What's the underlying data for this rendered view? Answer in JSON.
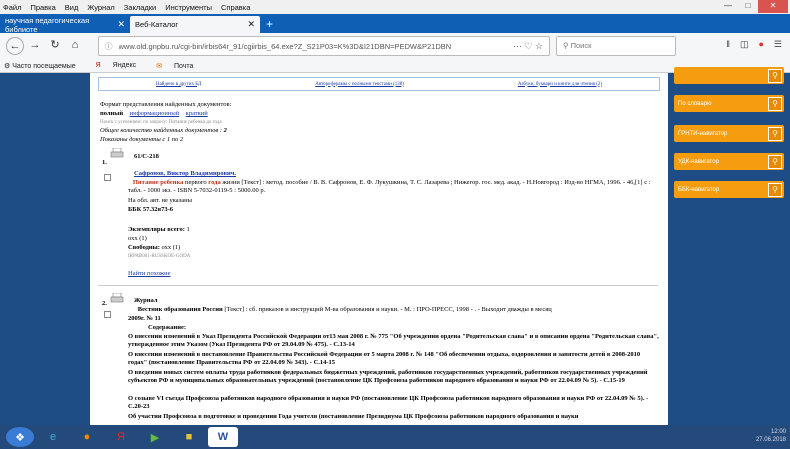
{
  "menu": [
    "Файл",
    "Правка",
    "Вид",
    "Журнал",
    "Закладки",
    "Инструменты",
    "Справка"
  ],
  "tabs": [
    {
      "label": "научная педагогическая библиоте"
    },
    {
      "label": "Веб-Каталог"
    }
  ],
  "url": "www.old.gnpbu.ru/cgi-bin/irbis64r_91/cgiirbis_64.exe?Z_S21P03=K%3D&I21DBN=PEDW&P21DBN",
  "search_placeholder": "Поиск",
  "bookmarks": [
    "Часто посещаемые",
    "Яндекс",
    "Почта"
  ],
  "sidebar": [
    {
      "label": "По словарю"
    },
    {
      "label": "ГРНТИ-навигатор"
    },
    {
      "label": "УДК-навигатор"
    },
    {
      "label": "ББК-навигатор"
    }
  ],
  "toplinks": [
    "Найдено в других БД",
    "Автореферамы с полными текстами (138)",
    "Азбуки, буквари и книги для чтения (2)"
  ],
  "format_title": "Формат представления найденных документов:",
  "formats": {
    "full": "полный",
    "info": "информационный",
    "short": "краткий"
  },
  "query_note": "Поиск с усечением: по запросу: Питание ребенка до года",
  "total_label": "Общее количество найденных документов :",
  "total": "2",
  "shown_label": "Показаны документы с 1 по 2",
  "rec1": {
    "num": "1.",
    "code": "61/С-218",
    "author": "Сафронов, Виктор Владимирович.",
    "title_red": "Питание ребенка",
    "title_rest": " первого ",
    "title_red2": "года",
    "desc": " жизни [Текст] : метод. пособие / В. В. Сафронов, Е. Ф. Лукушкина, Т. С. Лазарева ; Нижегор. гос. мед. акад. - Н.Новгород : Изд-во НГМА, 1996. - 46,[1] с : табл. - 1000 экз. - ISBN 5-7032-0119-5 : 5000.00 р.",
    "note": "На обл. авт. не указаны",
    "bbk": "ББК 57.32я73-6",
    "copies_label": "Экземпляры всего:",
    "copies": "1",
    "okh1": "охх (1)",
    "free_label": "Свободны:",
    "free": "охх (1)",
    "code2": "IRPAB001-RUSSKOE-GODA",
    "similar": "Найти похожие"
  },
  "rec2": {
    "num": "2.",
    "type": "Журнал",
    "title": "Вестник образования России",
    "desc": " [Текст] : сб. приказов и инструкций М-ва образования и науки. - М. : ПРО-ПРЕСС, 1998 - . - Выходит дважды в месяц",
    "issue": "2009г. № 11",
    "contents": "Содержание:",
    "items": [
      "О внесении изменений в Указ Президента Российской Федерации от13 мая 2008 г. № 775 \"Об учреждении ордена \"Родительская слава\" и в описании ордена \"Родительская слава\", утвержденное этим Указом (Указ Президента РФ от 29.04.09 № 475). - С.13-14",
      "О внесении изменений в постановление Правительства Российской Федерации от 5 марта 2008 г. № 148 \"Об обеспечении отдыха, оздоровления и занятости детей в 2008-2010 годах\" (постановление Правительства РФ от 22.04.09 № 343). - С.14-15",
      "О введении новых систем оплаты труда работников федеральных бюджетных учреждений, работников государственных учреждений, работников государственных учреждений субъектов РФ и муниципальных образовательных учреждений (постановление ЦК Профсоюза работников народного образования и науки РФ от 22.04.09 № 5). - С.15-19",
      "О созыве VI съезда Профсоюза работников народного образования и науки РФ (постановление ЦК Профсоюза работников народного образования и науки РФ от 22.04.09 № 5). - С.20-23",
      "Об участии Профсоюза в подготовке и проведении Года учителя (постановление Президиума ЦК Профсоюза работников народного образования и науки"
    ]
  },
  "clock": {
    "time": "12:00",
    "date": "27.06.2018"
  }
}
